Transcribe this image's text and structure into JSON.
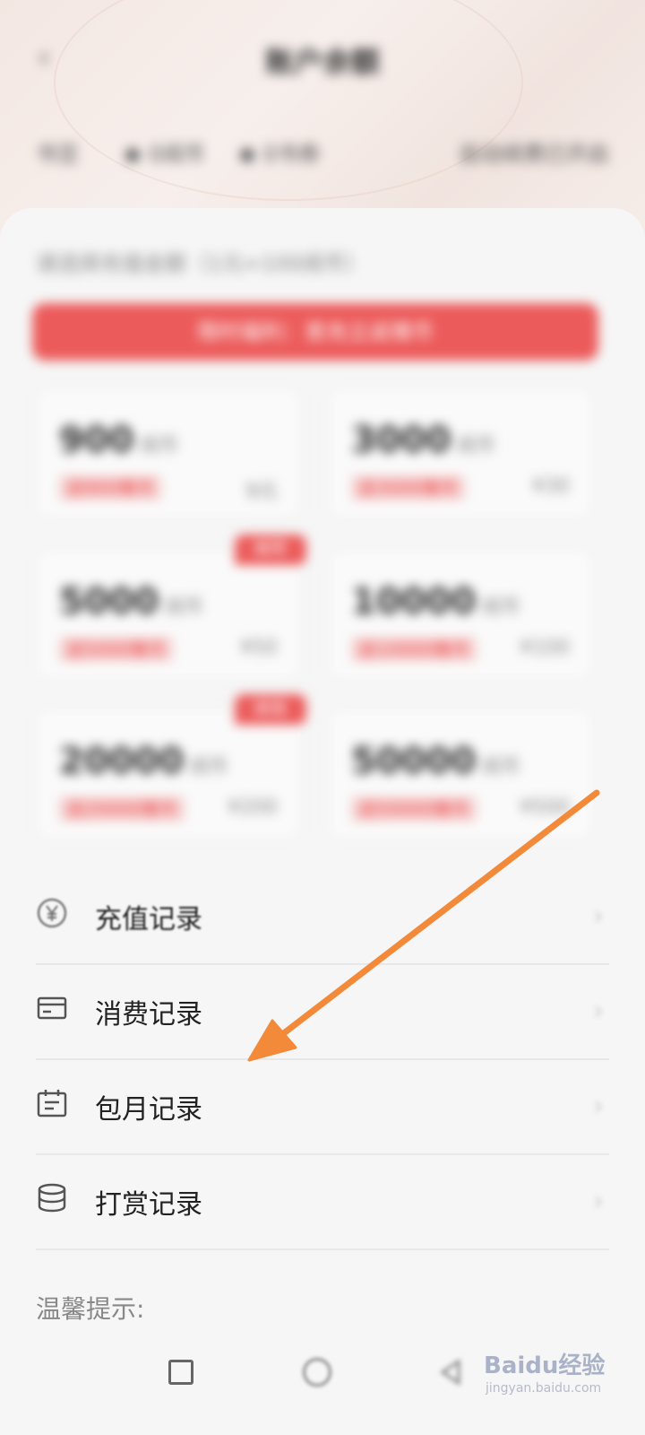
{
  "header": {
    "title": "账户余额",
    "balance_label": "书豆",
    "coin_a": "0阅币",
    "coin_b": "0书券",
    "auto_renew": "自动续费已开启"
  },
  "recharge": {
    "subtitle": "请选择充值金额（1元=100阅币）",
    "banner": "限时福利：首充立返赠币",
    "cards": [
      {
        "amount": "900",
        "unit": "阅币",
        "bonus": "送900赠币",
        "price": "9元",
        "tag": ""
      },
      {
        "amount": "3000",
        "unit": "阅币",
        "bonus": "送3000赠币",
        "price": "¥30",
        "tag": ""
      },
      {
        "amount": "5000",
        "unit": "阅币",
        "bonus": "送5000赠币",
        "price": "¥50",
        "tag": "推荐"
      },
      {
        "amount": "10000",
        "unit": "阅币",
        "bonus": "送10000赠币",
        "price": "¥100",
        "tag": ""
      },
      {
        "amount": "20000",
        "unit": "阅币",
        "bonus": "送20000赠币",
        "price": "¥200",
        "tag": "超值"
      },
      {
        "amount": "50000",
        "unit": "阅币",
        "bonus": "送50000赠币",
        "price": "¥500",
        "tag": ""
      }
    ]
  },
  "menu": {
    "items": [
      {
        "label": "充值记录",
        "icon": "yen-icon"
      },
      {
        "label": "消费记录",
        "icon": "card-icon"
      },
      {
        "label": "包月记录",
        "icon": "calendar-icon"
      },
      {
        "label": "打赏记录",
        "icon": "coins-icon"
      }
    ],
    "chevron": "›"
  },
  "tips": "温馨提示:",
  "watermark": {
    "logo": "Baidu经验",
    "sub": "jingyan.baidu.com"
  },
  "colors": {
    "accent": "#ec5b5b",
    "arrow": "#f28a3a"
  }
}
